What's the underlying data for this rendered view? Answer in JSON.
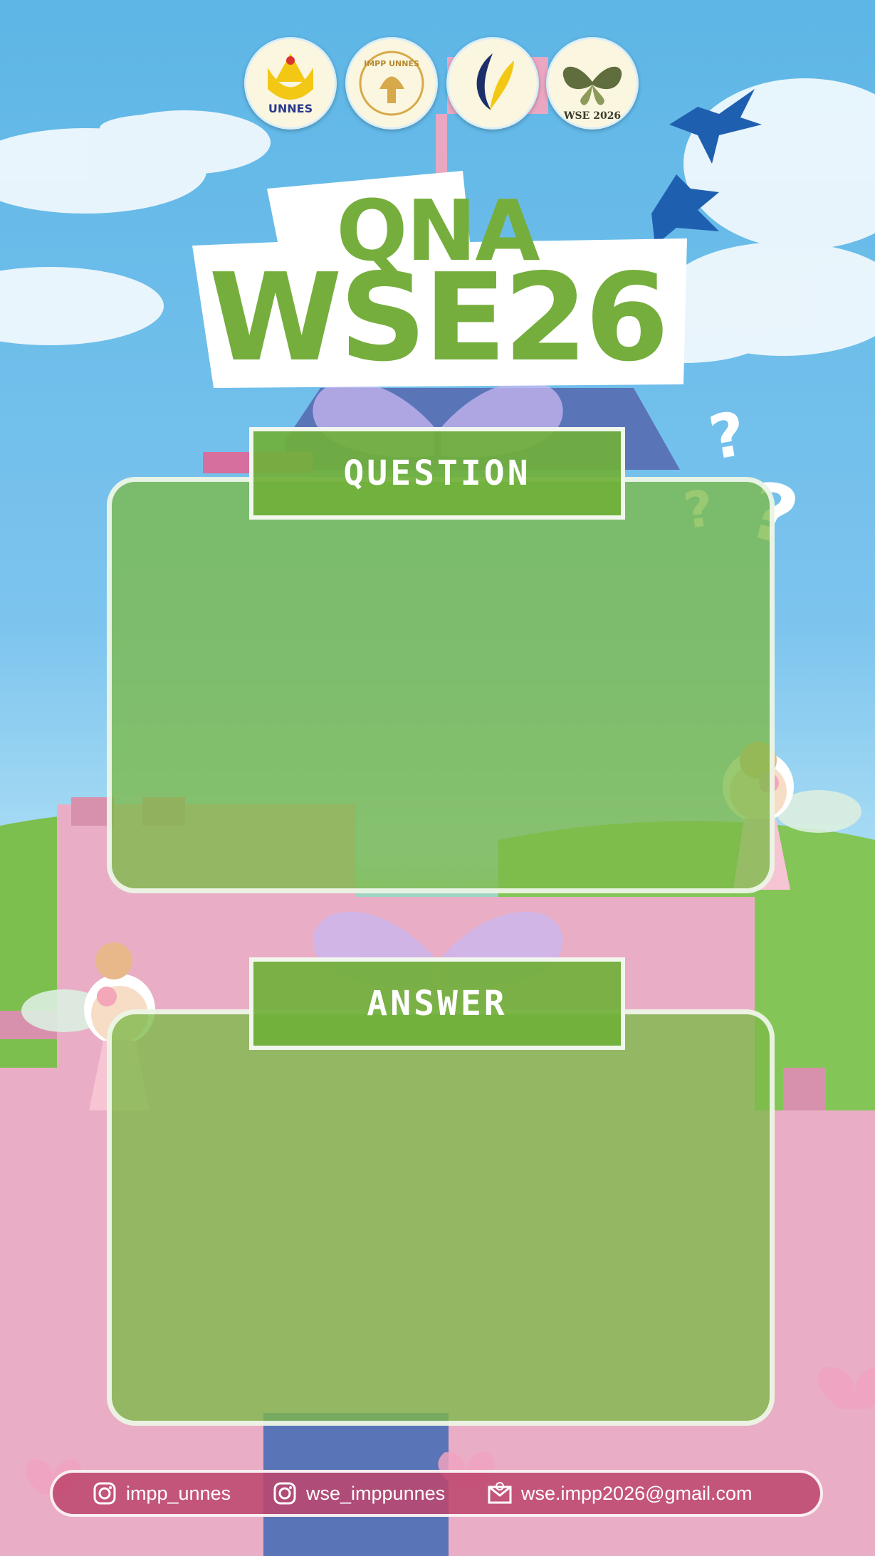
{
  "logos": [
    {
      "name": "unnes-logo",
      "text": "UNNES"
    },
    {
      "name": "impp-unnes-logo",
      "text": "IMPP UNNES"
    },
    {
      "name": "quill-logo",
      "text": ""
    },
    {
      "name": "wse-2026-logo",
      "text": "WSE 2026"
    }
  ],
  "title": {
    "line1": "QNA",
    "line2": "WSE26"
  },
  "question": {
    "label": "QUESTION"
  },
  "answer": {
    "label": "ANSWER"
  },
  "footer": {
    "items": [
      {
        "icon": "instagram-icon",
        "text": "impp_unnes"
      },
      {
        "icon": "instagram-icon",
        "text": "wse_imppunnes"
      },
      {
        "icon": "mail-icon",
        "text": "wse.impp2026@gmail.com"
      }
    ]
  },
  "colors": {
    "sky": "#5db6e6",
    "title_green": "#76ae3d",
    "panel_green": "#7cba48",
    "castle_pink": "#e7a9c2",
    "footer_bar": "#be466e"
  }
}
